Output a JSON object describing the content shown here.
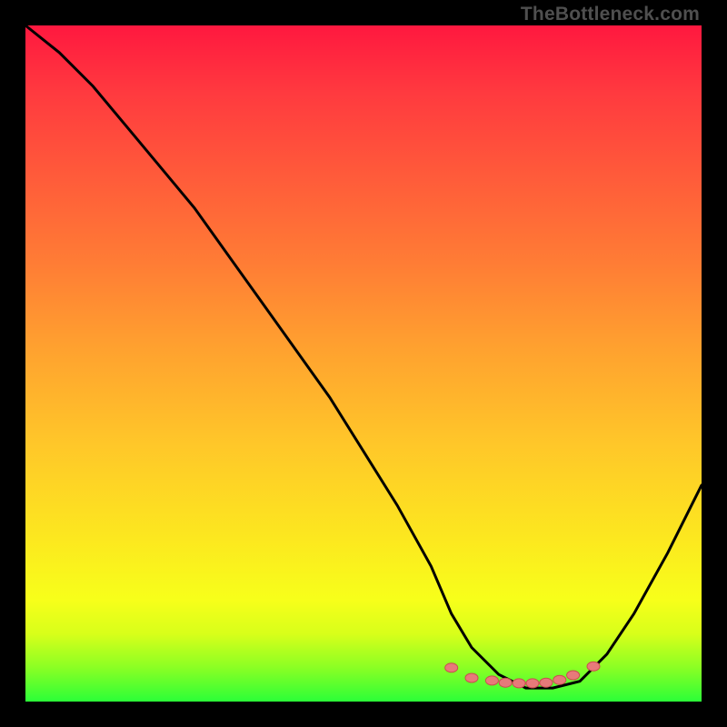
{
  "watermark": "TheBottleneck.com",
  "chart_data": {
    "type": "line",
    "title": "",
    "xlabel": "",
    "ylabel": "",
    "xlim": [
      0,
      100
    ],
    "ylim": [
      0,
      100
    ],
    "series": [
      {
        "name": "curve",
        "x": [
          0,
          5,
          10,
          15,
          20,
          25,
          30,
          35,
          40,
          45,
          50,
          55,
          60,
          63,
          66,
          70,
          74,
          78,
          82,
          86,
          90,
          95,
          100
        ],
        "y": [
          100,
          96,
          91,
          85,
          79,
          73,
          66,
          59,
          52,
          45,
          37,
          29,
          20,
          13,
          8,
          4,
          2,
          2,
          3,
          7,
          13,
          22,
          32
        ]
      },
      {
        "name": "markers",
        "x": [
          63,
          66,
          69,
          71,
          73,
          75,
          77,
          79,
          81,
          84
        ],
        "y": [
          5.0,
          3.5,
          3.1,
          2.8,
          2.7,
          2.7,
          2.8,
          3.2,
          3.9,
          5.2
        ]
      }
    ],
    "annotations": [],
    "colors": {
      "curve": "#000000",
      "marker_fill": "#e77a7a",
      "marker_stroke": "#c94f4f",
      "gradient_top": "#ff183f",
      "gradient_bottom": "#2bff38"
    }
  }
}
